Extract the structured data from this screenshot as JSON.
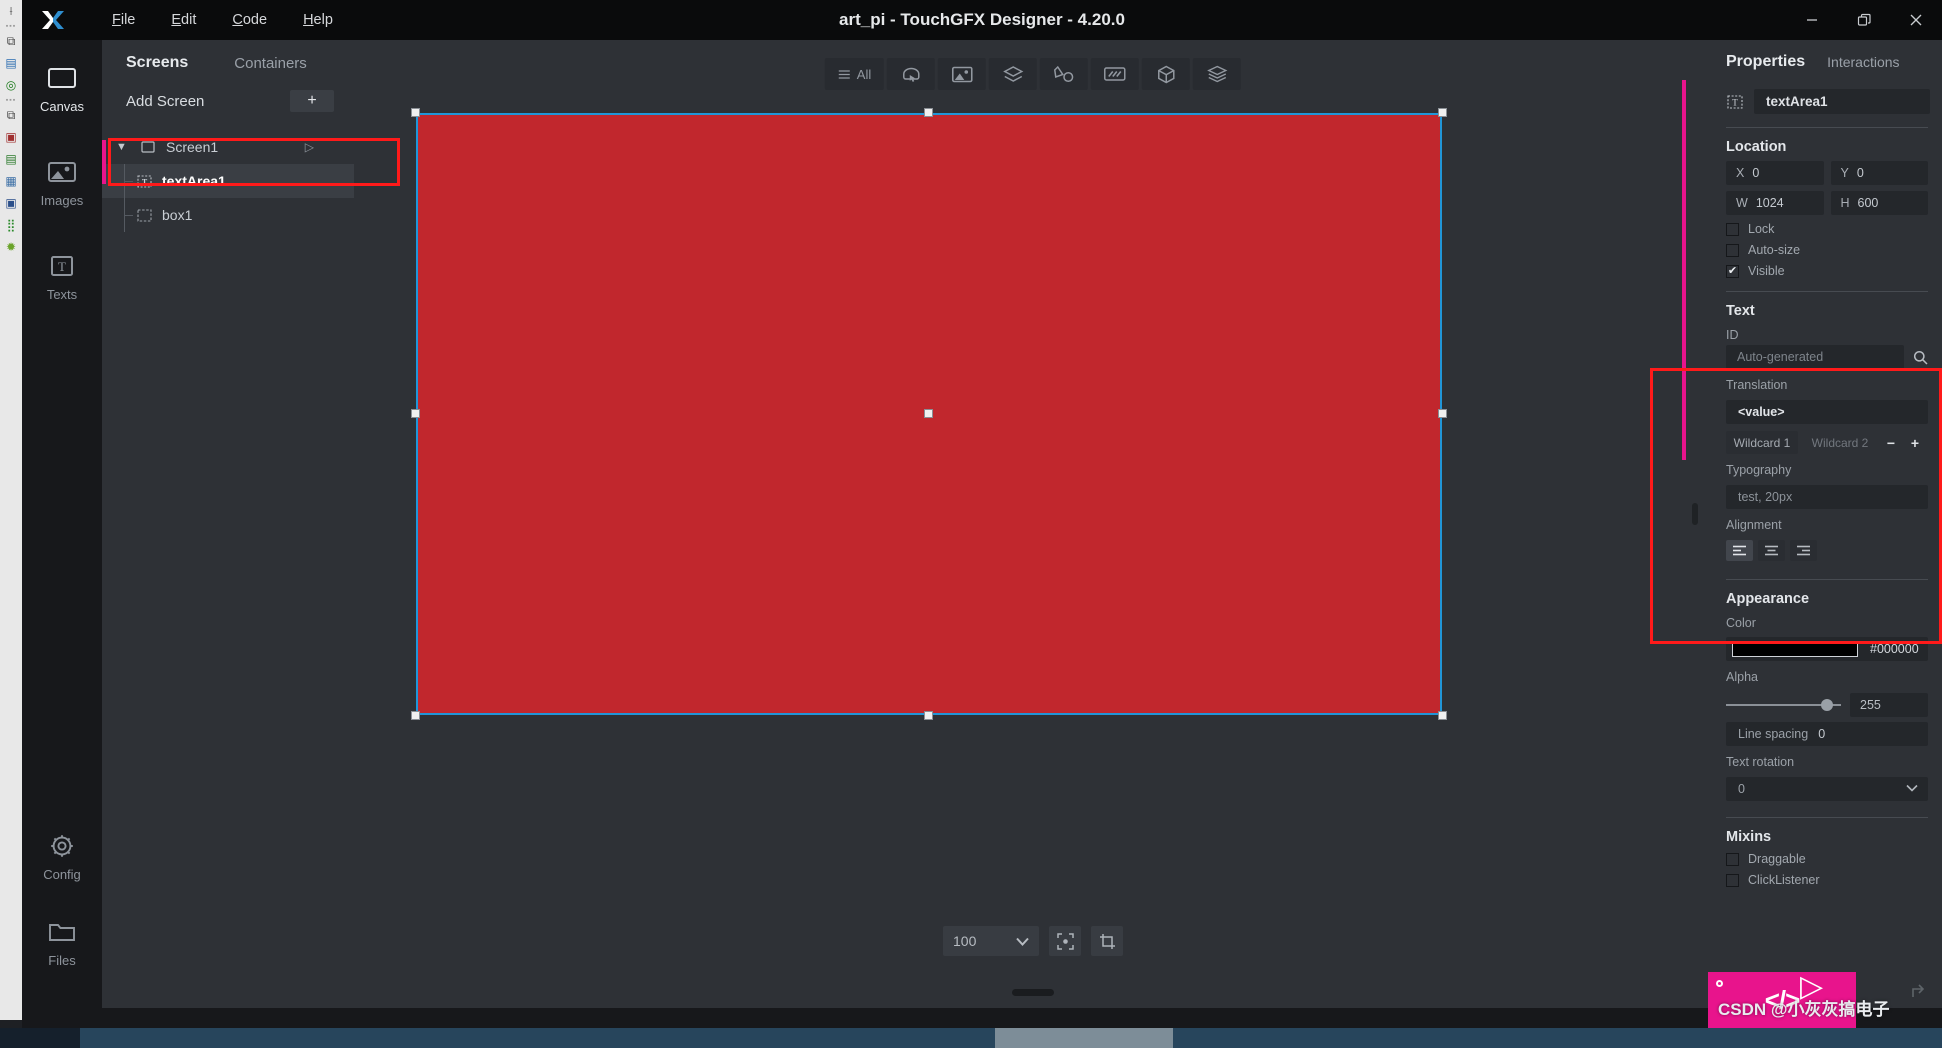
{
  "window": {
    "title": "art_pi - TouchGFX Designer - 4.20.0",
    "logo": "x-logo",
    "controls": [
      {
        "name": "minimize-button",
        "glyph": "—"
      },
      {
        "name": "restore-button",
        "glyph": "❐"
      },
      {
        "name": "close-button",
        "glyph": "✕"
      }
    ]
  },
  "menu": {
    "items": [
      {
        "label": "File",
        "mnemonic": "F"
      },
      {
        "label": "Edit",
        "mnemonic": "E"
      },
      {
        "label": "Code",
        "mnemonic": "C"
      },
      {
        "label": "Help",
        "mnemonic": "H"
      }
    ]
  },
  "rail": {
    "items": [
      {
        "label": "Canvas",
        "icon": "canvas-icon",
        "active": true
      },
      {
        "label": "Images",
        "icon": "images-icon",
        "active": false
      },
      {
        "label": "Texts",
        "icon": "texts-icon",
        "active": false
      }
    ],
    "bottom_items": [
      {
        "label": "Config",
        "icon": "gear-icon"
      },
      {
        "label": "Files",
        "icon": "folder-icon"
      }
    ],
    "hamburger": "hamburger-icon"
  },
  "screens_panel": {
    "tabs": [
      {
        "label": "Screens",
        "active": true
      },
      {
        "label": "Containers",
        "active": false
      }
    ],
    "add_screen_label": "Add Screen",
    "add_button_glyph": "+",
    "tree": [
      {
        "label": "Screen1",
        "icon": "screen-icon",
        "level": 0,
        "expanded": true,
        "selected": false,
        "play": true
      },
      {
        "label": "textArea1",
        "icon": "text-icon",
        "level": 1,
        "expanded": false,
        "selected": true,
        "play": false
      },
      {
        "label": "box1",
        "icon": "box-icon",
        "level": 1,
        "expanded": false,
        "selected": false,
        "play": false
      }
    ]
  },
  "canvas": {
    "toolbar": [
      {
        "name": "filter-all-button",
        "label": "All",
        "icon": "list-icon"
      },
      {
        "name": "interaction-filter-button",
        "label": "",
        "icon": "cursor-touch-icon"
      },
      {
        "name": "image-filter-button",
        "label": "",
        "icon": "image-icon"
      },
      {
        "name": "container-filter-button",
        "label": "",
        "icon": "layers-icon"
      },
      {
        "name": "shape-filter-button",
        "label": "",
        "icon": "shapes-icon"
      },
      {
        "name": "textarea-filter-button",
        "label": "",
        "icon": "textfield-icon"
      },
      {
        "name": "3d-filter-button",
        "label": "",
        "icon": "cube-icon"
      },
      {
        "name": "stack-filter-button",
        "label": "",
        "icon": "stack-icon"
      }
    ],
    "selected_widget_color": "#c1272d",
    "selection_border_color": "#2196d8",
    "zoom_value": "100",
    "zoom_buttons": [
      {
        "name": "fit-to-screen-button",
        "icon": "fit-icon"
      },
      {
        "name": "crop-button",
        "icon": "crop-icon"
      }
    ]
  },
  "properties": {
    "tabs": [
      {
        "label": "Properties",
        "active": true
      },
      {
        "label": "Interactions",
        "active": false
      }
    ],
    "widget_icon": "text-icon",
    "widget_name": "textArea1",
    "location": {
      "title": "Location",
      "x_label": "X",
      "x_value": "0",
      "y_label": "Y",
      "y_value": "0",
      "w_label": "W",
      "w_value": "1024",
      "h_label": "H",
      "h_value": "600",
      "lock_label": "Lock",
      "lock_checked": false,
      "autosize_label": "Auto-size",
      "autosize_checked": false,
      "visible_label": "Visible",
      "visible_checked": true
    },
    "text": {
      "title": "Text",
      "id_label": "ID",
      "id_placeholder": "Auto-generated",
      "id_search_icon": "search-icon",
      "translation_label": "Translation",
      "translation_value": "<value>",
      "wildcard1": "Wildcard 1",
      "wildcard2": "Wildcard 2",
      "wildcard_minus": "−",
      "wildcard_plus": "+",
      "typography_label": "Typography",
      "typography_value": "test, 20px",
      "alignment_label": "Alignment",
      "alignment_options": [
        "align-left-icon",
        "align-center-icon",
        "align-right-icon"
      ],
      "alignment_selected": 0
    },
    "appearance": {
      "title": "Appearance",
      "color_label": "Color",
      "color_hex": "#000000",
      "alpha_label": "Alpha",
      "alpha_value": "255",
      "line_spacing_label": "Line spacing",
      "line_spacing_value": "0",
      "text_rotation_label": "Text rotation",
      "text_rotation_value": "0"
    },
    "mixins": {
      "title": "Mixins",
      "items": [
        {
          "label": "Draggable",
          "checked": false
        },
        {
          "label": "ClickListener",
          "checked": false
        }
      ]
    }
  },
  "annotations": {
    "highlight_color": "#ff1a1a",
    "marker_color": "#e8148c"
  },
  "watermark": {
    "text": "CSDN @小灰灰搞电子",
    "badge_color": "#e8148c",
    "code_glyph": "</>",
    "play_glyph": "▷"
  },
  "ide_strip": {
    "icons": [
      "cursor-icon",
      "sep",
      "copy-icon",
      "outline-icon",
      "target-icon",
      "sep",
      "copy2-icon",
      "image-map-icon",
      "clipboard-check-icon",
      "table-icon",
      "screen-pen-icon",
      "node-tree-icon",
      "bug-icon"
    ]
  }
}
